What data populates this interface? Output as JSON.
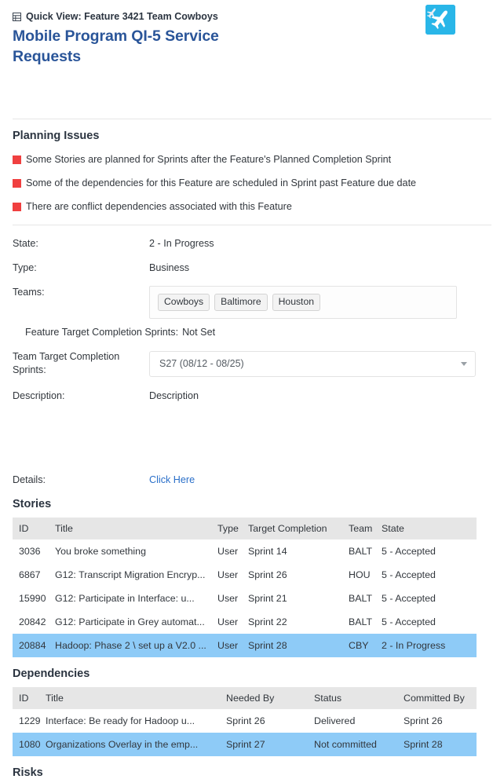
{
  "header": {
    "breadcrumb_icon": "table-grid-icon",
    "breadcrumb": "Quick View: Feature 3421 Team Cowboys",
    "title": "Mobile Program QI-5 Service Requests",
    "logo_icon": "airplane-logo-icon",
    "logo_bg": "#29b6e8"
  },
  "planning": {
    "heading": "Planning Issues",
    "marker_color": "#f04040",
    "issues": [
      "Some Stories are planned for Sprints after the Feature's Planned Completion Sprint",
      "Some of the dependencies for this Feature are scheduled in Sprint past Feature due date",
      "There are conflict dependencies associated with this Feature"
    ]
  },
  "fields": {
    "state_label": "State:",
    "state_value": "2 - In Progress",
    "type_label": "Type:",
    "type_value": "Business",
    "teams_label": "Teams:",
    "teams": [
      "Cowboys",
      "Baltimore",
      "Houston"
    ],
    "feature_target_label": "Feature Target Completion Sprints:",
    "feature_target_value": "Not Set",
    "team_target_label": "Team Target Completion Sprints:",
    "team_target_value": "S27 (08/12 - 08/25)",
    "team_target_caret": "chevron-down-icon",
    "description_label": "Description:",
    "description_value": "Description",
    "details_label": "Details:",
    "details_link": "Click Here"
  },
  "stories": {
    "heading": "Stories",
    "columns": [
      "ID",
      "Title",
      "Type",
      "Target Completion",
      "Team",
      "State"
    ],
    "rows": [
      {
        "id": "3036",
        "title": "You broke something",
        "type": "User",
        "target": "Sprint 14",
        "team": "BALT",
        "state": "5 - Accepted",
        "selected": false,
        "target_warn": false
      },
      {
        "id": "6867",
        "title": "G12: Transcript Migration Encryp...",
        "type": "User",
        "target": "Sprint 26",
        "team": "HOU",
        "state": "5 - Accepted",
        "selected": false,
        "target_warn": false
      },
      {
        "id": "15990",
        "title": "G12: Participate in Interface: u...",
        "type": "User",
        "target": "Sprint 21",
        "team": "BALT",
        "state": "5 - Accepted",
        "selected": false,
        "target_warn": false
      },
      {
        "id": "20842",
        "title": "G12: Participate in Grey automat...",
        "type": "User",
        "target": "Sprint 22",
        "team": "BALT",
        "state": "5 - Accepted",
        "selected": false,
        "target_warn": false
      },
      {
        "id": "20884",
        "title": "Hadoop: Phase 2 \\ set up a V2.0 ...",
        "type": "User",
        "target": "Sprint 28",
        "team": "CBY",
        "state": "2 - In Progress",
        "selected": true,
        "target_warn": true
      }
    ]
  },
  "dependencies": {
    "heading": "Dependencies",
    "columns": [
      "ID",
      "Title",
      "Needed By",
      "Status",
      "Committed By"
    ],
    "rows": [
      {
        "id": "1229",
        "title": "Interface: Be ready for Hadoop u...",
        "needed_by": "Sprint 26",
        "status": "Delivered",
        "committed_by": "Sprint 26",
        "selected": false,
        "needed_warn": false,
        "committed_warn": false
      },
      {
        "id": "1080",
        "title": "Organizations Overlay in the emp...",
        "needed_by": "Sprint 27",
        "status": "Not committed",
        "committed_by": "Sprint 28",
        "selected": true,
        "needed_warn": true,
        "committed_warn": true
      }
    ]
  },
  "risks": {
    "heading": "Risks"
  },
  "colors": {
    "title_blue": "#2a5599",
    "link_blue": "#2a6fc9",
    "warn_red": "#e8335c",
    "selected_row": "#8ecbf7",
    "table_header": "#e6e6e6"
  }
}
